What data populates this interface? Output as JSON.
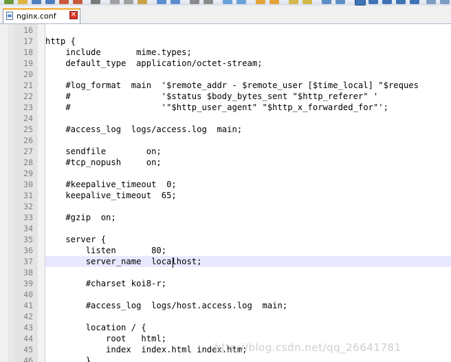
{
  "tab": {
    "label": "nginx.conf",
    "close_icon": "close-icon",
    "file_icon": "file-icon"
  },
  "editor": {
    "current_line": "37",
    "lines": [
      {
        "num": "16",
        "text": ""
      },
      {
        "num": "17",
        "text": "http {"
      },
      {
        "num": "18",
        "text": "    include       mime.types;"
      },
      {
        "num": "19",
        "text": "    default_type  application/octet-stream;"
      },
      {
        "num": "20",
        "text": ""
      },
      {
        "num": "21",
        "text": "    #log_format  main  '$remote_addr - $remote_user [$time_local] \"$reques"
      },
      {
        "num": "22",
        "text": "    #                  '$status $body_bytes_sent \"$http_referer\" '"
      },
      {
        "num": "23",
        "text": "    #                  '\"$http_user_agent\" \"$http_x_forwarded_for\"';"
      },
      {
        "num": "24",
        "text": ""
      },
      {
        "num": "25",
        "text": "    #access_log  logs/access.log  main;"
      },
      {
        "num": "26",
        "text": ""
      },
      {
        "num": "27",
        "text": "    sendfile        on;"
      },
      {
        "num": "28",
        "text": "    #tcp_nopush     on;"
      },
      {
        "num": "29",
        "text": ""
      },
      {
        "num": "30",
        "text": "    #keepalive_timeout  0;"
      },
      {
        "num": "31",
        "text": "    keepalive_timeout  65;"
      },
      {
        "num": "32",
        "text": ""
      },
      {
        "num": "33",
        "text": "    #gzip  on;"
      },
      {
        "num": "34",
        "text": ""
      },
      {
        "num": "35",
        "text": "    server {"
      },
      {
        "num": "36",
        "text": "        listen       80;"
      },
      {
        "num": "37",
        "text": "        server_name  localhost;"
      },
      {
        "num": "38",
        "text": ""
      },
      {
        "num": "39",
        "text": "        #charset koi8-r;"
      },
      {
        "num": "40",
        "text": ""
      },
      {
        "num": "41",
        "text": "        #access_log  logs/host.access.log  main;"
      },
      {
        "num": "42",
        "text": ""
      },
      {
        "num": "43",
        "text": "        location / {"
      },
      {
        "num": "44",
        "text": "            root   html;"
      },
      {
        "num": "45",
        "text": "            index  index.html index.htm;"
      },
      {
        "num": "46",
        "text": "        }"
      }
    ]
  },
  "watermark": "http://blog.csdn.net/qq_26641781",
  "colors": {
    "current_line_bg": "#e8e8ff",
    "gutter_bg": "#e4e4e4",
    "line_number": "#808080",
    "tab_accent": "#f5a623"
  }
}
